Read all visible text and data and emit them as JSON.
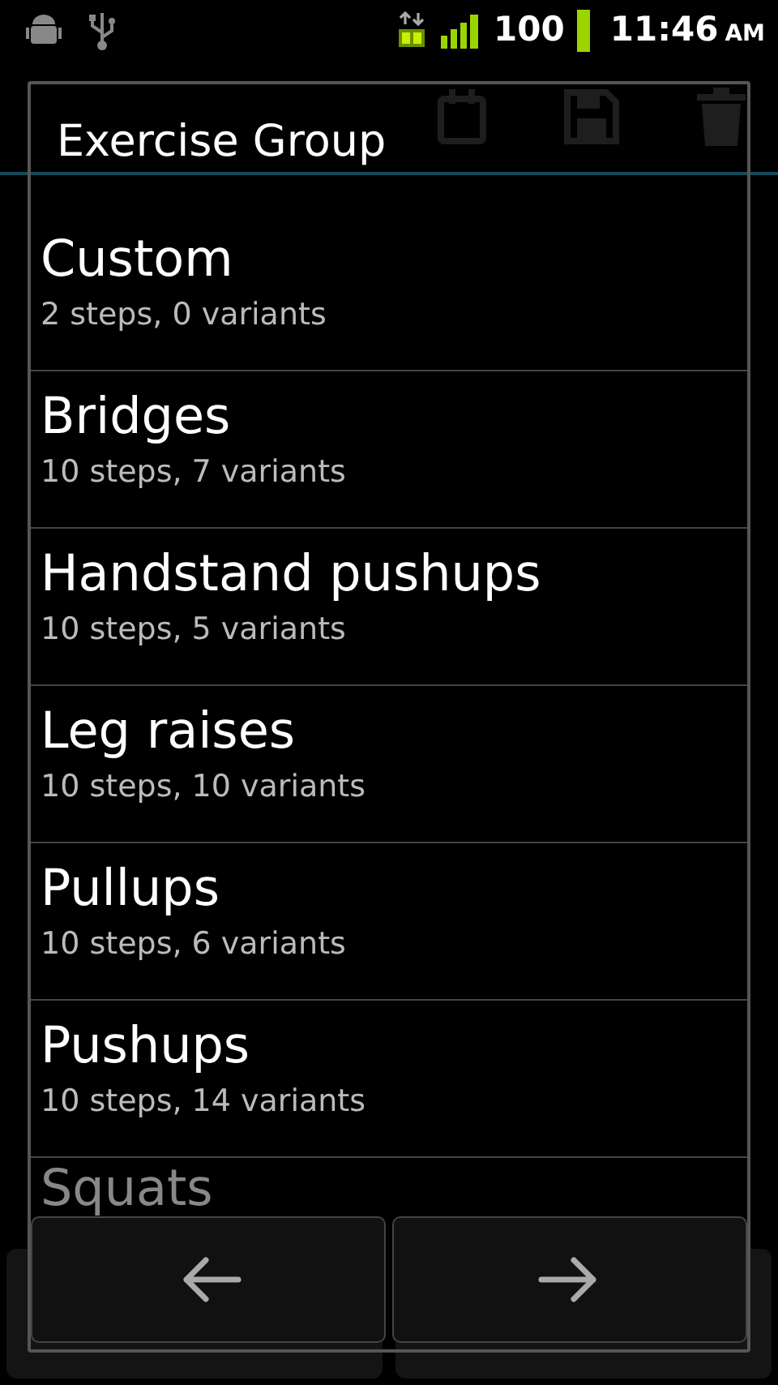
{
  "status_bar": {
    "battery_text": "100",
    "time": "11:46",
    "meridiem": "AM"
  },
  "dialog": {
    "title": "Exercise Group",
    "items": [
      {
        "name": "Custom",
        "detail": "2 steps, 0 variants"
      },
      {
        "name": "Bridges",
        "detail": "10 steps, 7 variants"
      },
      {
        "name": "Handstand pushups",
        "detail": "10 steps, 5 variants"
      },
      {
        "name": "Leg raises",
        "detail": "10 steps, 10 variants"
      },
      {
        "name": "Pullups",
        "detail": "10 steps, 6 variants"
      },
      {
        "name": "Pushups",
        "detail": "10 steps, 14 variants"
      },
      {
        "name": "Squats"
      }
    ],
    "buttons": [
      {
        "kind": "back"
      },
      {
        "kind": "forward"
      }
    ]
  }
}
